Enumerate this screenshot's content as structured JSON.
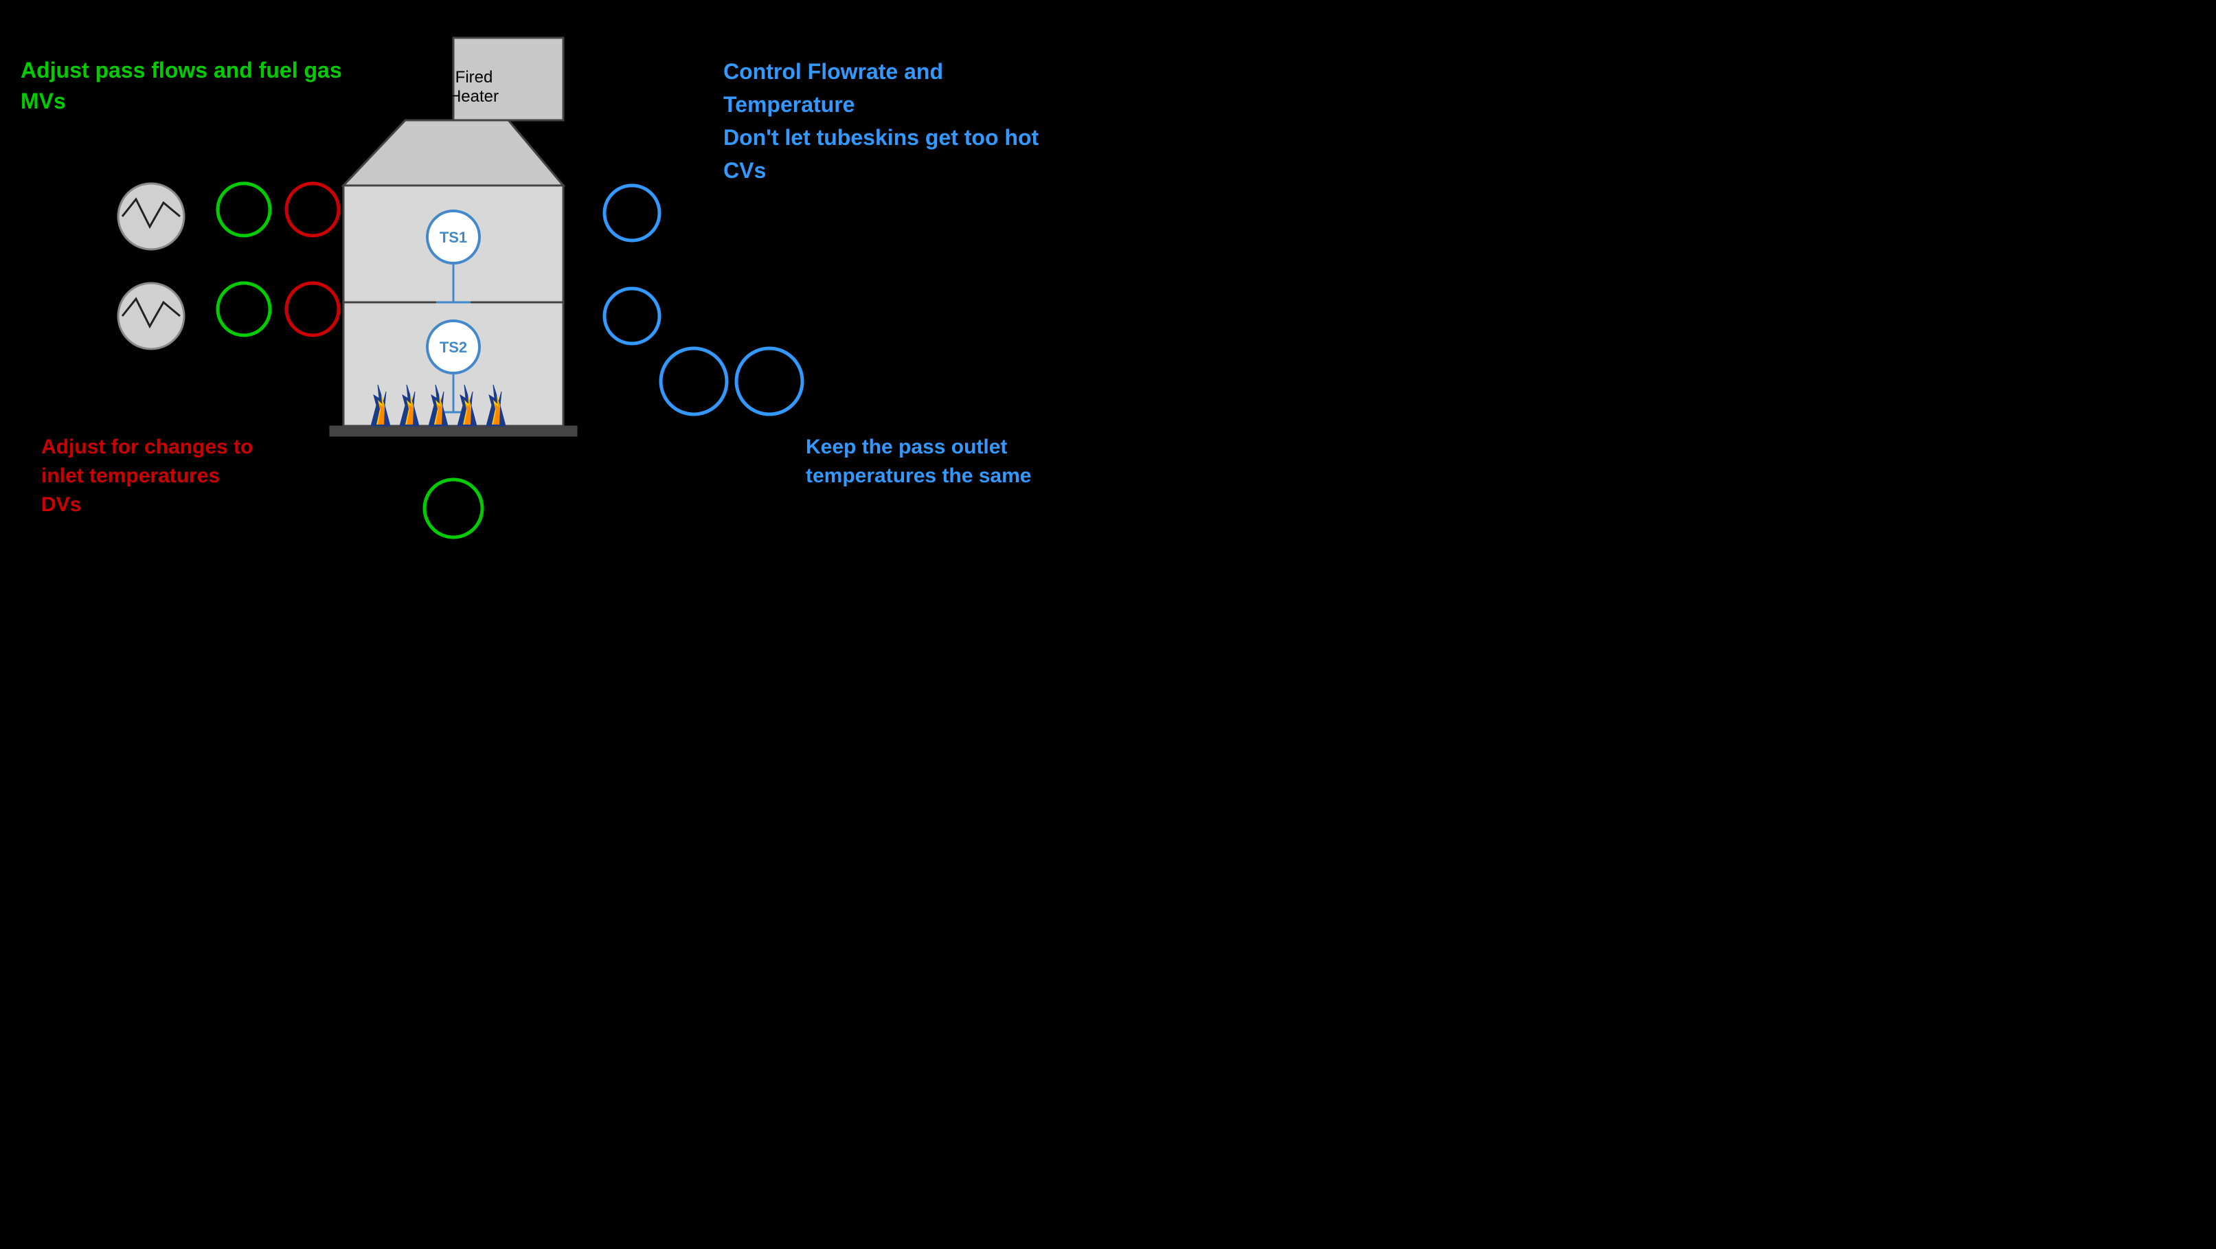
{
  "left": {
    "mv_line1": "Adjust pass flows and fuel gas",
    "mv_line2": "MVs",
    "dv_line1": "Adjust for changes to",
    "dv_line2": "inlet temperatures",
    "dv_line3": "DVs"
  },
  "right": {
    "cv_line1": "Control Flowrate and Temperature",
    "cv_line2": "Don't let tubeskins get too hot",
    "cv_line3": "CVs",
    "keep_line1": "Keep the pass outlet",
    "keep_line2": "temperatures the same"
  },
  "heater": {
    "label_line1": "Fired",
    "label_line2": "Heater",
    "ts1_label": "TS1",
    "ts2_label": "TS2"
  },
  "colors": {
    "green": "#00cc00",
    "red": "#cc0000",
    "blue": "#3399ff",
    "heater_bg": "#d0d0d0",
    "heater_stroke": "#444",
    "black": "#000000",
    "white": "#ffffff",
    "flame_yellow": "#ffcc00",
    "flame_orange": "#ff8800",
    "sensor_blue": "#4488cc"
  }
}
